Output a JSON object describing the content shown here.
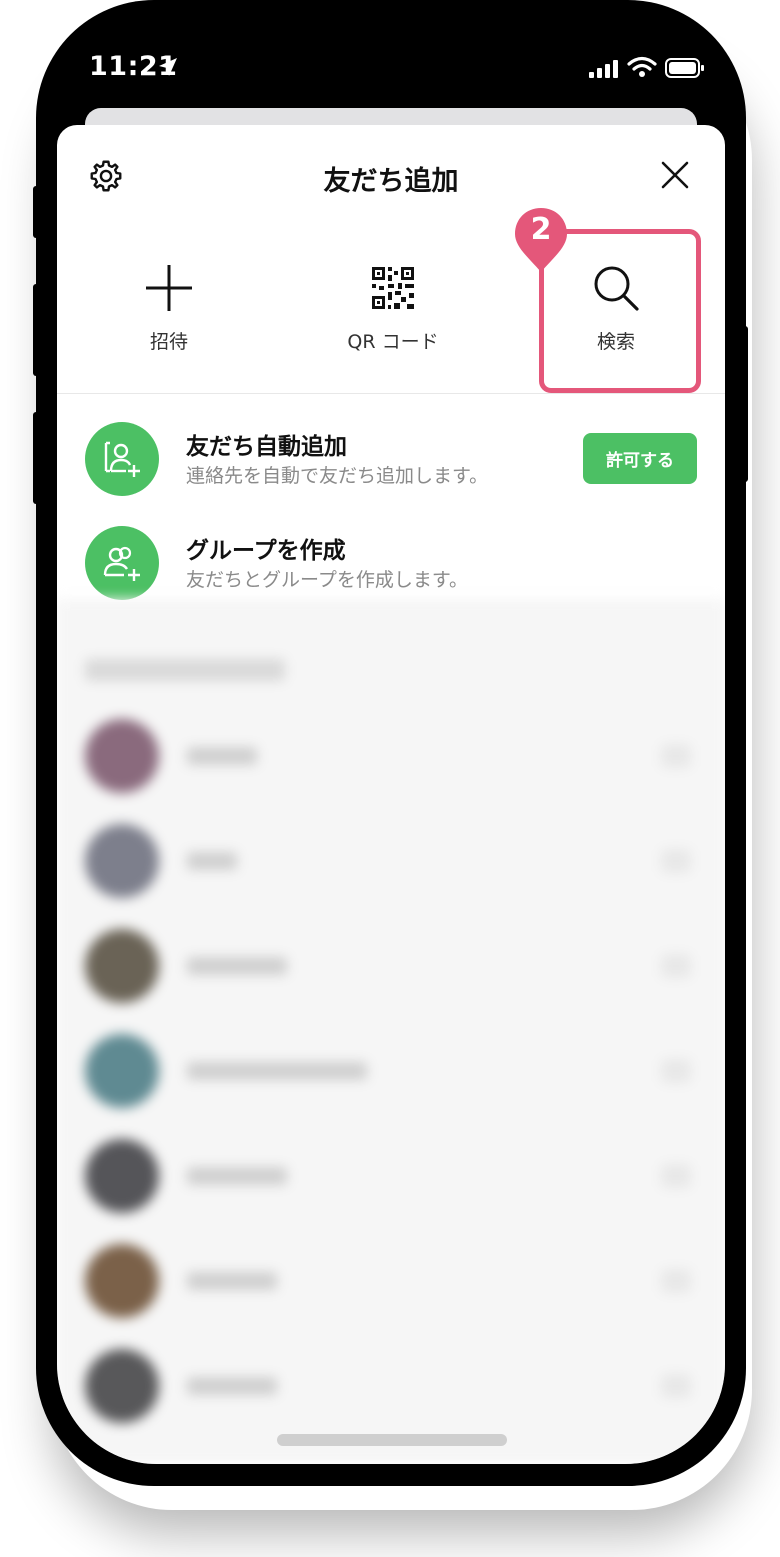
{
  "status_bar": {
    "time": "11:21"
  },
  "sheet": {
    "title": "友だち追加",
    "actions": [
      {
        "label": "招待",
        "icon": "plus-icon"
      },
      {
        "label": "QR コード",
        "icon": "qr-code-icon"
      },
      {
        "label": "検索",
        "icon": "search-icon"
      }
    ],
    "step_badge": "2",
    "highlight_color": "#e4577a"
  },
  "rows": [
    {
      "title": "友だち自動追加",
      "subtitle": "連絡先を自動で友だち追加します。",
      "button": "許可する",
      "icon": "auto-add-friend-icon"
    },
    {
      "title": "グループを作成",
      "subtitle": "友だちとグループを作成します。",
      "icon": "create-group-icon"
    }
  ],
  "colors": {
    "accent": "#4cc064",
    "badge": "#e4577a"
  }
}
